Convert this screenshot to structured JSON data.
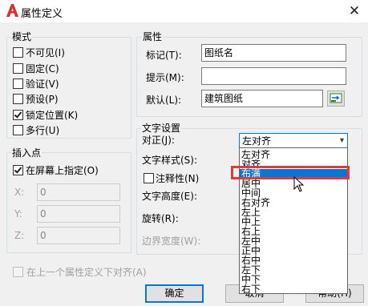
{
  "window": {
    "title": "属性定义",
    "close_glyph": "✕",
    "icon": "autocad-a-icon",
    "icon_color": "#e32b2b"
  },
  "mode": {
    "group_label": "模式",
    "items": [
      {
        "label": "不可见(I)",
        "checked": false
      },
      {
        "label": "固定(C)",
        "checked": false
      },
      {
        "label": "验证(V)",
        "checked": false
      },
      {
        "label": "预设(P)",
        "checked": false
      },
      {
        "label": "锁定位置(K)",
        "checked": true
      },
      {
        "label": "多行(U)",
        "checked": false
      }
    ]
  },
  "attribute": {
    "group_label": "属性",
    "tag_label": "标记(T):",
    "tag_value": "图纸名",
    "prompt_label": "提示(M):",
    "prompt_value": "",
    "default_label": "默认(L):",
    "default_value": "建筑图纸",
    "field_icon": "insert-field-icon"
  },
  "insertion": {
    "group_label": "插入点",
    "onscreen_label": "在屏幕上指定(O)",
    "onscreen_checked": true,
    "x_label": "X:",
    "y_label": "Y:",
    "z_label": "Z:",
    "x_value": "0",
    "y_value": "0",
    "z_value": "0"
  },
  "text_settings": {
    "group_label": "文字设置",
    "justify_label": "对正(J):",
    "justify_value": "左对齐",
    "style_label": "文字样式(S):",
    "annotative_label": "注释性(N)",
    "annotative_checked": false,
    "height_label": "文字高度(E):",
    "rotation_label": "旋转(R):",
    "boundary_label": "边界宽度(W):"
  },
  "justify_dropdown": {
    "options": [
      "左对齐",
      "对齐",
      "布满",
      "居中",
      "中间",
      "右对齐",
      "左上",
      "中上",
      "右上",
      "左中",
      "正中",
      "右中",
      "左下",
      "中下",
      "右下"
    ],
    "selected": "布满",
    "highlight_color": "#e53935"
  },
  "align_below": {
    "label": "在上一个属性定义下对齐(A)",
    "checked": false
  },
  "buttons": {
    "ok": "确定",
    "cancel": "取消",
    "help": "帮助(H)"
  }
}
